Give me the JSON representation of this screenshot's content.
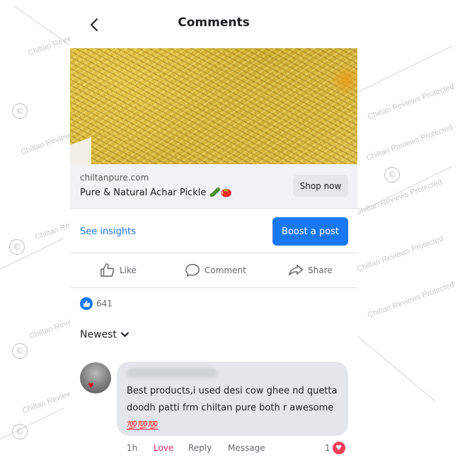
{
  "header": {
    "title": "Comments",
    "back_icon": "chevron-left-icon"
  },
  "ad": {
    "domain": "chiltanpure.com",
    "title": "Pure & Natural Achar Pickle 🥒🍅",
    "shop_label": "Shop now"
  },
  "insights": {
    "link_label": "See insights",
    "boost_label": "Boost a post"
  },
  "actions": [
    {
      "label": "Like",
      "icon": "thumbs-up-icon"
    },
    {
      "label": "Comment",
      "icon": "comment-icon"
    },
    {
      "label": "Share",
      "icon": "share-icon"
    }
  ],
  "reactions": {
    "count": "641",
    "icon": "like-reaction-icon"
  },
  "sort": {
    "label": "Newest"
  },
  "comment": {
    "text": "Best products,i used desi cow ghee nd quetta doodh patti frm chiltan pure both r awesome",
    "emoji": "💯💯💯",
    "time": "1h",
    "love_label": "Love",
    "reply_label": "Reply",
    "message_label": "Message",
    "reaction_count": "1"
  },
  "watermark": {
    "text": "Chiltan Reviews Protected",
    "short_text": "Chiltan Review",
    "symbol": "©"
  },
  "colors": {
    "accent": "#1877f2",
    "love": "#e0245e",
    "bubble": "#e4e6eb"
  }
}
